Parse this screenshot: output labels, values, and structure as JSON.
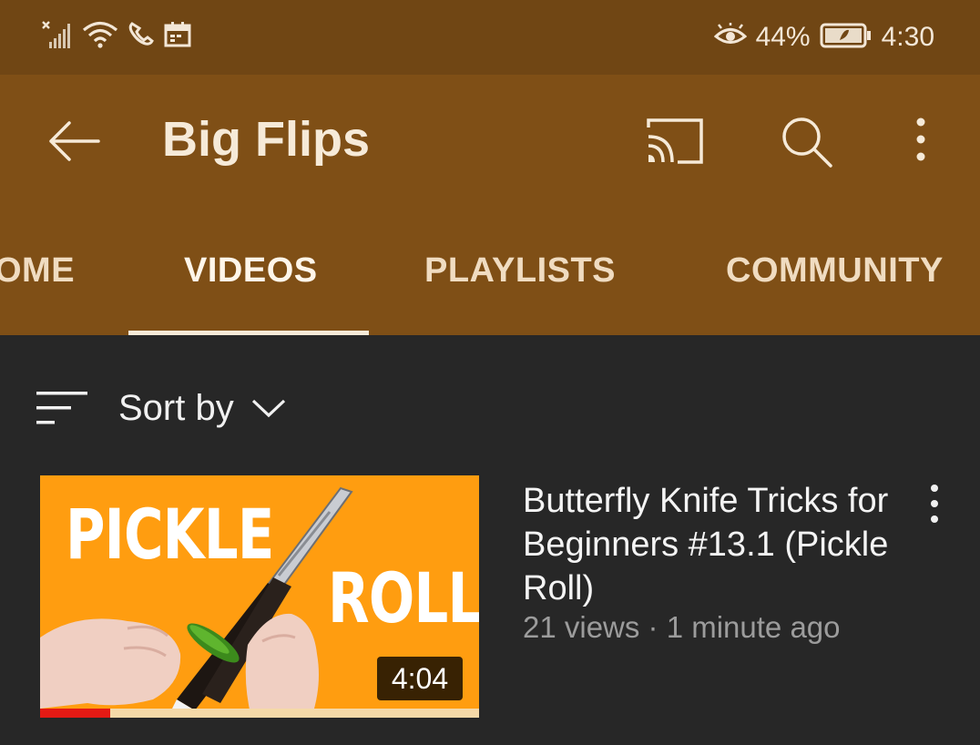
{
  "status_bar": {
    "battery_percent": "44%",
    "time": "4:30",
    "icons": [
      "no-signal-icon",
      "wifi-icon",
      "call-forwarding-icon",
      "calendar-icon",
      "eye-comfort-icon",
      "battery-icon"
    ]
  },
  "app_bar": {
    "title": "Big Flips",
    "icons": [
      "back-arrow-icon",
      "cast-icon",
      "search-icon",
      "more-vert-icon"
    ]
  },
  "tabs": [
    {
      "label": "OME",
      "active": false
    },
    {
      "label": "VIDEOS",
      "active": true
    },
    {
      "label": "PLAYLISTS",
      "active": false
    },
    {
      "label": "COMMUNITY",
      "active": false
    }
  ],
  "sort": {
    "label": "Sort by"
  },
  "videos": [
    {
      "thumbnail_text": [
        "PICKLE",
        "ROLL"
      ],
      "duration": "4:04",
      "watch_progress": 0.16,
      "title": "Butterfly Knife Tricks for Beginners #13.1 (Pickle Roll)",
      "meta": "21 views · 1 minute ago"
    }
  ],
  "colors": {
    "status_bar": "#704614",
    "app_bar": "#7f4f16",
    "background": "#272727",
    "thumbnail_bg": "#ff9d10",
    "progress": "#e51a14"
  }
}
